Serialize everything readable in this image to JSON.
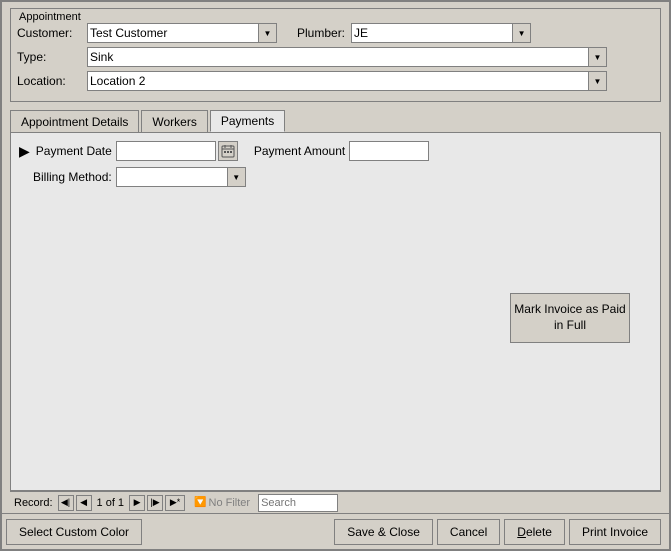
{
  "window": {
    "title": "Appointment"
  },
  "form": {
    "customer_label": "Customer:",
    "customer_value": "Test Customer",
    "plumber_label": "Plumber:",
    "plumber_value": "JE",
    "type_label": "Type:",
    "type_value": "Sink",
    "location_label": "Location:",
    "location_value": "Location 2"
  },
  "tabs": [
    {
      "label": "Appointment Details",
      "active": false
    },
    {
      "label": "Workers",
      "active": false
    },
    {
      "label": "Payments",
      "active": true
    }
  ],
  "payments": {
    "payment_date_label": "Payment Date",
    "payment_date_value": "",
    "payment_amount_label": "Payment Amount",
    "payment_amount_value": "",
    "billing_method_label": "Billing Method:",
    "billing_method_value": "",
    "mark_invoice_label": "Mark Invoice as Paid in Full"
  },
  "record_nav": {
    "label": "Record:",
    "first_icon": "◀◀",
    "prev_icon": "◀",
    "counter": "1 of 1",
    "next_icon": "▶",
    "last_icon": "▶▶",
    "new_icon": "▶*",
    "no_filter_icon": "🔽",
    "no_filter_text": "No Filter",
    "search_placeholder": "Search"
  },
  "bottom_buttons": [
    {
      "id": "select-custom-color",
      "label": "Select Custom Color"
    },
    {
      "id": "save-close",
      "label": "Save & Close"
    },
    {
      "id": "cancel",
      "label": "Cancel"
    },
    {
      "id": "delete",
      "label": "Delete",
      "underline_index": 0
    },
    {
      "id": "print-invoice",
      "label": "Print Invoice"
    }
  ]
}
